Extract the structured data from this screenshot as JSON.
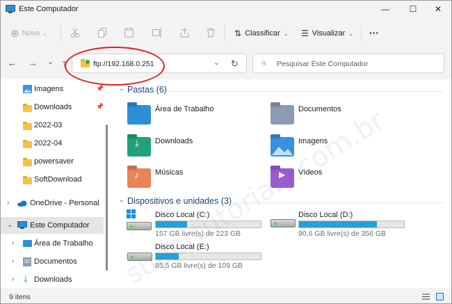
{
  "window": {
    "title": "Este Computador",
    "minimize_glyph": "—",
    "maximize_glyph": "☐",
    "close_glyph": "✕"
  },
  "toolbar": {
    "new_label": "Novo",
    "sort_label": "Classificar",
    "view_label": "Visualizar",
    "more_label": "···",
    "icons": [
      "cut-icon",
      "copy-icon",
      "paste-icon",
      "rename-icon",
      "share-icon",
      "delete-icon"
    ]
  },
  "navbar": {
    "address_value": "ftp://192.168.0.251",
    "search_placeholder": "Pesquisar Este Computador",
    "back_glyph": "←",
    "forward_glyph": "→",
    "up_glyph": "↑",
    "recent_glyph": "⌄",
    "refresh_glyph": "↻"
  },
  "sidebar": {
    "items": [
      {
        "label": "Imagens",
        "icon": "pictures-icon",
        "pinned": true
      },
      {
        "label": "Downloads",
        "icon": "folder-icon",
        "pinned": true
      },
      {
        "label": "2022-03",
        "icon": "folder-icon",
        "pinned": false
      },
      {
        "label": "2022-04",
        "icon": "folder-icon",
        "pinned": false
      },
      {
        "label": "powersaver",
        "icon": "folder-icon",
        "pinned": false
      },
      {
        "label": "SoftDownload",
        "icon": "folder-icon",
        "pinned": false
      },
      {
        "label": "OneDrive - Personal",
        "icon": "cloud-icon",
        "pinned": false
      },
      {
        "label": "Este Computador",
        "icon": "computer-icon",
        "pinned": false
      },
      {
        "label": "Área de Trabalho",
        "icon": "desktop-icon",
        "pinned": false
      },
      {
        "label": "Documentos",
        "icon": "documents-icon",
        "pinned": false
      },
      {
        "label": "Downloads",
        "icon": "download-icon",
        "pinned": false
      }
    ]
  },
  "folders_section": {
    "header": "Pastas (6)",
    "items": [
      {
        "label": "Área de Trabalho",
        "color": "#2b8fd6"
      },
      {
        "label": "Documentos",
        "color": "#8a9bb3"
      },
      {
        "label": "Downloads",
        "color": "#21a17a"
      },
      {
        "label": "Imagens",
        "color": "#3b8fe0"
      },
      {
        "label": "Músicas",
        "color": "#e8835a"
      },
      {
        "label": "Vídeos",
        "color": "#9b59d0"
      }
    ]
  },
  "drives_section": {
    "header": "Dispositivos e unidades (3)",
    "items": [
      {
        "label": "Disco Local (C:)",
        "free_text": "157 GB livre(s) de 223 GB",
        "used_fraction": 0.296,
        "windows_logo": true
      },
      {
        "label": "Disco Local (D:)",
        "free_text": "90,6 GB livre(s) de 356 GB",
        "used_fraction": 0.745,
        "windows_logo": false
      },
      {
        "label": "Disco Local (E:)",
        "free_text": "85,5 GB livre(s) de 109 GB",
        "used_fraction": 0.216,
        "windows_logo": false
      }
    ]
  },
  "status": {
    "item_count": "9 itens"
  },
  "watermark": "supertutoriais.com.br",
  "colors": {
    "accent": "#26a0da",
    "highlight_ring": "#e21d1d",
    "section_header": "#1e3f77"
  }
}
